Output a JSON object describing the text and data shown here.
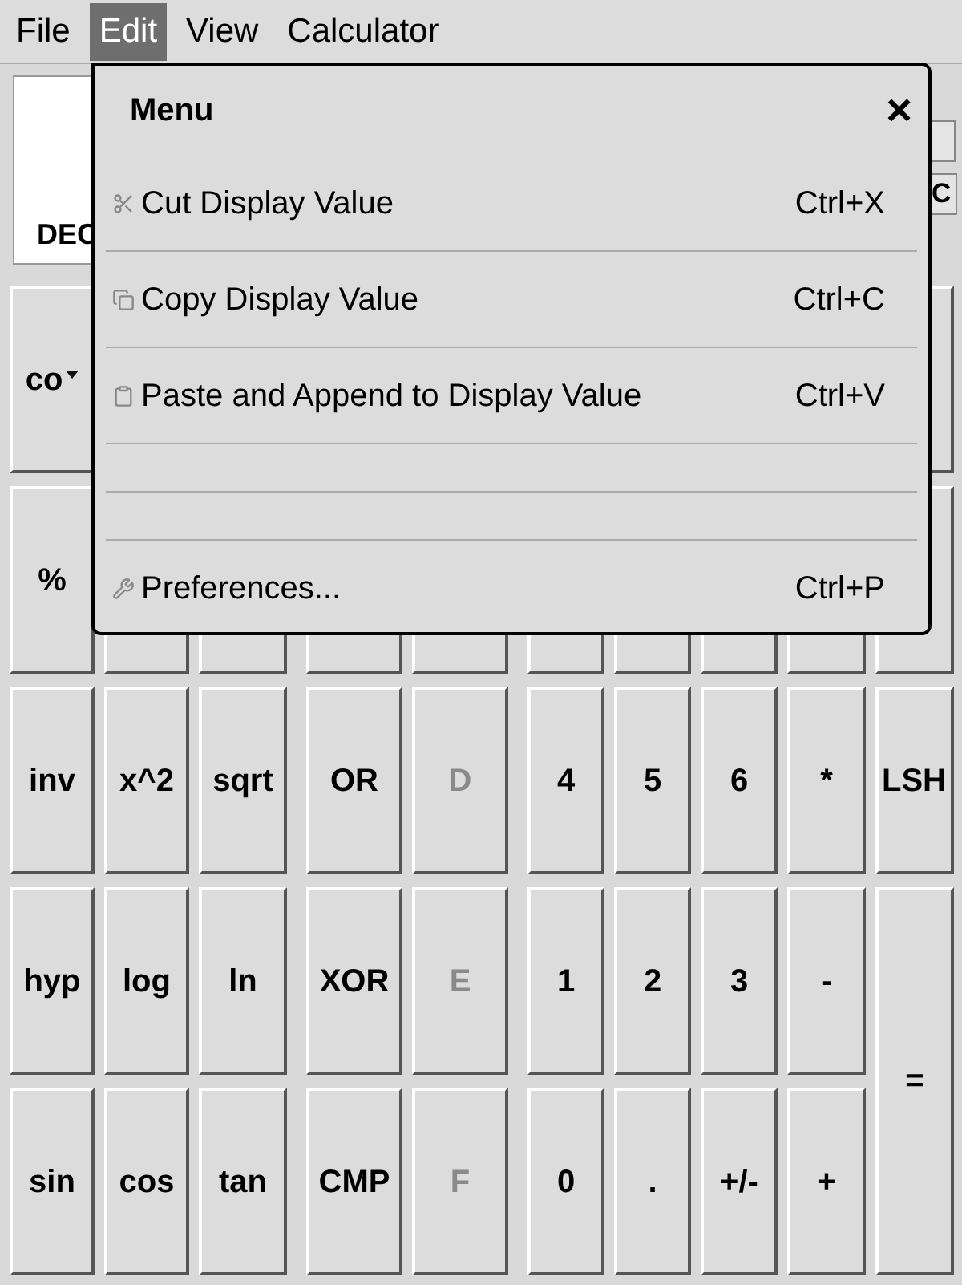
{
  "menubar": [
    {
      "label": "File",
      "selected": false
    },
    {
      "label": "Edit",
      "selected": true
    },
    {
      "label": "View",
      "selected": false
    },
    {
      "label": "Calculator",
      "selected": false
    }
  ],
  "display": {
    "base": "DEC",
    "side_button": "C"
  },
  "keypad": {
    "rows": [
      [
        {
          "label": "co",
          "kind": "dropdown",
          "disabled": false
        },
        {
          "kind": "edge"
        }
      ],
      [
        {
          "label": "%",
          "kind": "key",
          "disabled": false
        },
        {
          "kind": "blank"
        },
        {
          "kind": "blank"
        },
        {
          "kind": "blank"
        },
        {
          "kind": "blank"
        },
        {
          "kind": "blank"
        },
        {
          "kind": "blank"
        },
        {
          "kind": "blank"
        },
        {
          "kind": "blank"
        },
        {
          "kind": "blank"
        }
      ],
      [
        {
          "label": "inv",
          "kind": "key",
          "disabled": false
        },
        {
          "label": "x^2",
          "kind": "key",
          "disabled": false
        },
        {
          "label": "sqrt",
          "kind": "key",
          "disabled": false
        },
        {
          "label": "OR",
          "kind": "key",
          "disabled": false
        },
        {
          "label": "D",
          "kind": "key",
          "disabled": true
        },
        {
          "label": "4",
          "kind": "key",
          "disabled": false
        },
        {
          "label": "5",
          "kind": "key",
          "disabled": false
        },
        {
          "label": "6",
          "kind": "key",
          "disabled": false
        },
        {
          "label": "*",
          "kind": "key",
          "disabled": false
        },
        {
          "label": "LSH",
          "kind": "clipped",
          "disabled": false
        }
      ],
      [
        {
          "label": "hyp",
          "kind": "key",
          "disabled": false
        },
        {
          "label": "log",
          "kind": "key",
          "disabled": false
        },
        {
          "label": "ln",
          "kind": "key",
          "disabled": false
        },
        {
          "label": "XOR",
          "kind": "key",
          "disabled": false
        },
        {
          "label": "E",
          "kind": "key",
          "disabled": true
        },
        {
          "label": "1",
          "kind": "key",
          "disabled": false
        },
        {
          "label": "2",
          "kind": "key",
          "disabled": false
        },
        {
          "label": "3",
          "kind": "key",
          "disabled": false
        },
        {
          "label": "-",
          "kind": "key",
          "disabled": false
        },
        {
          "label": "=",
          "kind": "tall",
          "disabled": false
        }
      ],
      [
        {
          "label": "sin",
          "kind": "key",
          "disabled": false
        },
        {
          "label": "cos",
          "kind": "key",
          "disabled": false
        },
        {
          "label": "tan",
          "kind": "key",
          "disabled": false
        },
        {
          "label": "CMP",
          "kind": "key",
          "disabled": false
        },
        {
          "label": "F",
          "kind": "key",
          "disabled": true
        },
        {
          "label": "0",
          "kind": "key",
          "disabled": false
        },
        {
          "label": ".",
          "kind": "key",
          "disabled": false
        },
        {
          "label": "+/-",
          "kind": "key",
          "disabled": false
        },
        {
          "label": "+",
          "kind": "key",
          "disabled": false
        }
      ]
    ]
  },
  "menu": {
    "title": "Menu",
    "close": "×",
    "items": [
      {
        "kind": "item",
        "label": "Cut Display Value",
        "shortcut": "Ctrl+X"
      },
      {
        "kind": "item",
        "label": "Copy Display Value",
        "shortcut": "Ctrl+C"
      },
      {
        "kind": "item",
        "label": "Paste and Append to Display Value",
        "shortcut": "Ctrl+V"
      },
      {
        "kind": "separator"
      },
      {
        "kind": "separator"
      },
      {
        "kind": "item",
        "label": "Preferences...",
        "shortcut": "Ctrl+P"
      }
    ]
  }
}
